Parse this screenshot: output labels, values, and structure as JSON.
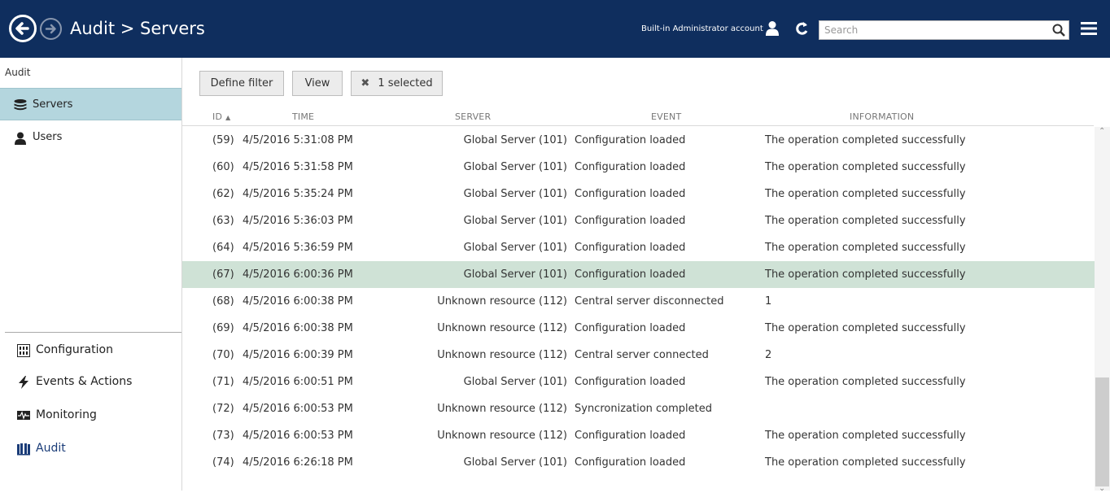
{
  "header": {
    "title": "Audit > Servers",
    "account_label": "Built-in Administrator account",
    "search_placeholder": "Search",
    "icons": [
      "back-arrow-icon",
      "forward-arrow-icon",
      "user-icon",
      "refresh-icon",
      "search-icon",
      "hamburger-menu-icon"
    ]
  },
  "sidebar": {
    "section_title": "Audit",
    "items": [
      {
        "label": "Servers",
        "icon": "servers-icon",
        "active": true
      },
      {
        "label": "Users",
        "icon": "user-icon",
        "active": false
      }
    ],
    "bottom_nav": [
      {
        "label": "Configuration",
        "icon": "configuration-icon"
      },
      {
        "label": "Events & Actions",
        "icon": "lightning-icon"
      },
      {
        "label": "Monitoring",
        "icon": "monitoring-icon"
      },
      {
        "label": "Audit",
        "icon": "book-icon",
        "current": true
      }
    ]
  },
  "toolbar": {
    "define_filter": "Define filter",
    "view": "View",
    "selected": "1 selected"
  },
  "table": {
    "columns": {
      "id": "ID",
      "time": "TIME",
      "server": "SERVER",
      "event": "EVENT",
      "information": "INFORMATION"
    },
    "rows": [
      {
        "id": "(59)",
        "time": "4/5/2016 5:31:08 PM",
        "server": "Global Server (101)",
        "event": "Configuration loaded",
        "info": "The operation completed successfully"
      },
      {
        "id": "(60)",
        "time": "4/5/2016 5:31:58 PM",
        "server": "Global Server (101)",
        "event": "Configuration loaded",
        "info": "The operation completed successfully"
      },
      {
        "id": "(62)",
        "time": "4/5/2016 5:35:24 PM",
        "server": "Global Server (101)",
        "event": "Configuration loaded",
        "info": "The operation completed successfully"
      },
      {
        "id": "(63)",
        "time": "4/5/2016 5:36:03 PM",
        "server": "Global Server (101)",
        "event": "Configuration loaded",
        "info": "The operation completed successfully"
      },
      {
        "id": "(64)",
        "time": "4/5/2016 5:36:59 PM",
        "server": "Global Server (101)",
        "event": "Configuration loaded",
        "info": "The operation completed successfully"
      },
      {
        "id": "(67)",
        "time": "4/5/2016 6:00:36 PM",
        "server": "Global Server (101)",
        "event": "Configuration loaded",
        "info": "The operation completed successfully",
        "selected": true
      },
      {
        "id": "(68)",
        "time": "4/5/2016 6:00:38 PM",
        "server": "Unknown resource (112)",
        "event": "Central server disconnected",
        "info": "1"
      },
      {
        "id": "(69)",
        "time": "4/5/2016 6:00:38 PM",
        "server": "Unknown resource (112)",
        "event": "Configuration loaded",
        "info": "The operation completed successfully"
      },
      {
        "id": "(70)",
        "time": "4/5/2016 6:00:39 PM",
        "server": "Unknown resource (112)",
        "event": "Central server connected",
        "info": "2"
      },
      {
        "id": "(71)",
        "time": "4/5/2016 6:00:51 PM",
        "server": "Global Server (101)",
        "event": "Configuration loaded",
        "info": "The operation completed successfully"
      },
      {
        "id": "(72)",
        "time": "4/5/2016 6:00:53 PM",
        "server": "Unknown resource (112)",
        "event": "Syncronization completed",
        "info": ""
      },
      {
        "id": "(73)",
        "time": "4/5/2016 6:00:53 PM",
        "server": "Unknown resource (112)",
        "event": "Configuration loaded",
        "info": "The operation completed successfully"
      },
      {
        "id": "(74)",
        "time": "4/5/2016 6:26:18 PM",
        "server": "Global Server (101)",
        "event": "Configuration loaded",
        "info": "The operation completed successfully"
      }
    ]
  },
  "colors": {
    "header_bg": "#0f2e5e",
    "sidebar_active_bg": "#b4d6de",
    "row_selected_bg": "#cfe2d6",
    "current_nav_text": "#1a3c78"
  }
}
